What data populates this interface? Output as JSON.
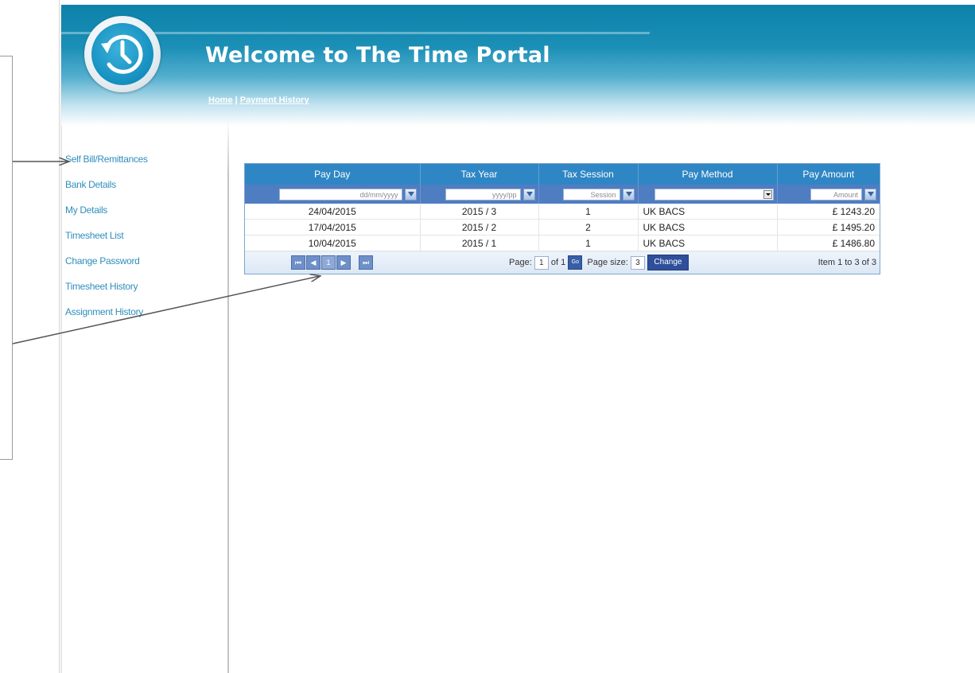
{
  "header": {
    "title": "Welcome to The Time Portal",
    "breadcrumb_home": "Home",
    "breadcrumb_sep": " | ",
    "breadcrumb_current": "Payment History",
    "logo_icon": "history-clock-icon"
  },
  "sidebar": {
    "items": [
      {
        "label": "Self Bill/Remittances"
      },
      {
        "label": "Bank Details"
      },
      {
        "label": "My Details"
      },
      {
        "label": "Timesheet List"
      },
      {
        "label": "Change Password"
      },
      {
        "label": "Timesheet History"
      },
      {
        "label": "Assignment History"
      }
    ]
  },
  "grid": {
    "columns": [
      "Pay Day",
      "Tax Year",
      "Tax Session",
      "Pay Method",
      "Pay Amount"
    ],
    "filters": {
      "pay_day_placeholder": "dd/mm/yyyy",
      "tax_year_placeholder": "yyyy/pp",
      "tax_session_placeholder": "Session",
      "pay_method_value": "",
      "pay_amount_placeholder": "Amount"
    },
    "rows": [
      {
        "pay_day": "24/04/2015",
        "tax_year": "2015 / 3",
        "tax_session": "1",
        "pay_method": "UK BACS",
        "pay_amount": "£ 1243.20"
      },
      {
        "pay_day": "17/04/2015",
        "tax_year": "2015 / 2",
        "tax_session": "2",
        "pay_method": "UK BACS",
        "pay_amount": "£ 1495.20"
      },
      {
        "pay_day": "10/04/2015",
        "tax_year": "2015 / 1",
        "tax_session": "1",
        "pay_method": "UK BACS",
        "pay_amount": "£ 1486.80"
      }
    ],
    "pager": {
      "first": "⏮",
      "prev": "◀",
      "current_page_button": "1",
      "next": "▶",
      "last": "⏭",
      "page_label": "Page:",
      "page_value": "1",
      "of_label": "of 1",
      "go_label": "Go",
      "page_size_label": "Page size:",
      "page_size_value": "3",
      "change_label": "Change",
      "item_summary": "Item 1 to 3 of 3"
    }
  },
  "colors": {
    "header_blue": "#0c82aa",
    "grid_header": "#2f86c4",
    "filter_bar": "#4f7dc2",
    "sidebar_link": "#2f8fbd"
  }
}
